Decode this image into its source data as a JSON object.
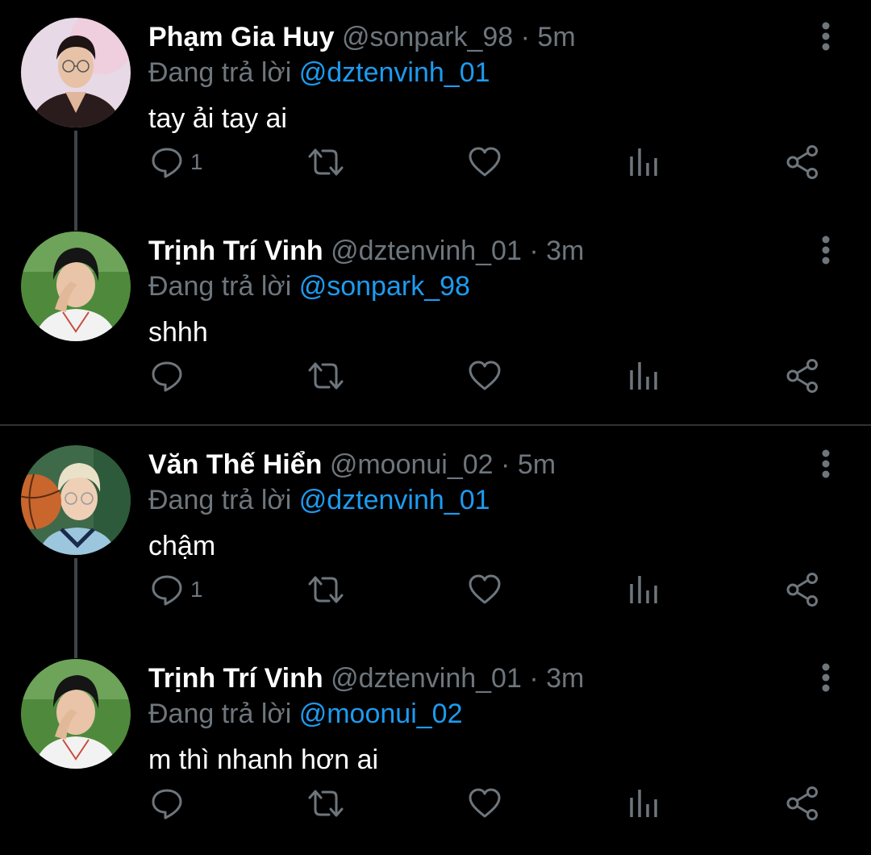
{
  "colors": {
    "background": "#000000",
    "text": "#ffffff",
    "muted": "#6e767d",
    "link": "#1d9bf0",
    "thread_line": "#3d4349",
    "divider": "#2f3336"
  },
  "tweets": [
    {
      "name": "Phạm Gia Huy",
      "handle": "@sonpark_98",
      "separator": "·",
      "time": "5m",
      "reply_prefix": "Đang trả lời",
      "reply_to": "@dztenvinh_01",
      "text": "tay ải tay ai",
      "reply_count": "1",
      "avatar_icon": "avatar-photo"
    },
    {
      "name": "Trịnh Trí Vinh",
      "handle": "@dztenvinh_01",
      "separator": "·",
      "time": "3m",
      "reply_prefix": "Đang trả lời",
      "reply_to": "@sonpark_98",
      "text": "shhh",
      "reply_count": "",
      "avatar_icon": "avatar-photo"
    },
    {
      "name": "Văn Thế Hiển",
      "handle": "@moonui_02",
      "separator": "·",
      "time": "5m",
      "reply_prefix": "Đang trả lời",
      "reply_to": "@dztenvinh_01",
      "text": "chậm",
      "reply_count": "1",
      "avatar_icon": "avatar-photo"
    },
    {
      "name": "Trịnh Trí Vinh",
      "handle": "@dztenvinh_01",
      "separator": "·",
      "time": "3m",
      "reply_prefix": "Đang trả lời",
      "reply_to": "@moonui_02",
      "text": "m thì nhanh hơn ai",
      "reply_count": "",
      "avatar_icon": "avatar-photo"
    }
  ],
  "action_icons": [
    "reply-icon",
    "retweet-icon",
    "like-icon",
    "analytics-icon",
    "share-icon"
  ]
}
